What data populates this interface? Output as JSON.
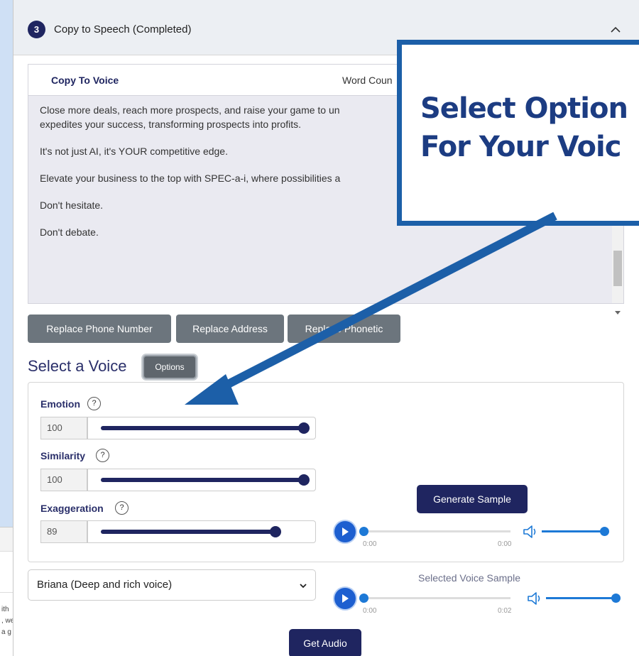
{
  "background_window": {
    "text_lines": [
      "ith",
      ", we",
      "a g"
    ]
  },
  "step": {
    "number": "3",
    "title": "Copy to Speech (Completed)"
  },
  "copy": {
    "tab_label": "Copy To Voice",
    "word_count_label": "Word Coun",
    "paragraphs": [
      "Close more deals, reach more prospects, and raise your game to un",
      "expedites your success, transforming prospects into profits.",
      "It's not just AI, it's YOUR competitive edge.",
      "Elevate your business to the top with SPEC-a-i, where possibilities a",
      "Don't hesitate.",
      "Don't debate."
    ]
  },
  "replace_buttons": {
    "phone": "Replace Phone Number",
    "address": "Replace Address",
    "phonetic": "Replace Phonetic"
  },
  "voice": {
    "heading": "Select a Voice",
    "options_label": "Options",
    "help_glyph": "?",
    "emotion": {
      "label": "Emotion",
      "value": "100",
      "fraction": 1.0
    },
    "similarity": {
      "label": "Similarity",
      "value": "100",
      "fraction": 1.0
    },
    "exaggeration": {
      "label": "Exaggeration",
      "value": "89",
      "fraction": 0.86
    },
    "generate_label": "Generate Sample",
    "generated_player": {
      "time_current": "0:00",
      "time_total": "0:00"
    },
    "selected_voice": "Briana (Deep and rich voice)",
    "sample_label": "Selected Voice Sample",
    "sample_player": {
      "time_current": "0:00",
      "time_total": "0:02"
    },
    "get_audio_label": "Get Audio"
  },
  "callout": {
    "line1": "Select Option",
    "line2": "For Your Voic"
  },
  "colors": {
    "navy": "#1f2560",
    "callout_blue": "#1c5fa8",
    "player_blue": "#1d79d6",
    "gray_button": "#6c757d"
  }
}
